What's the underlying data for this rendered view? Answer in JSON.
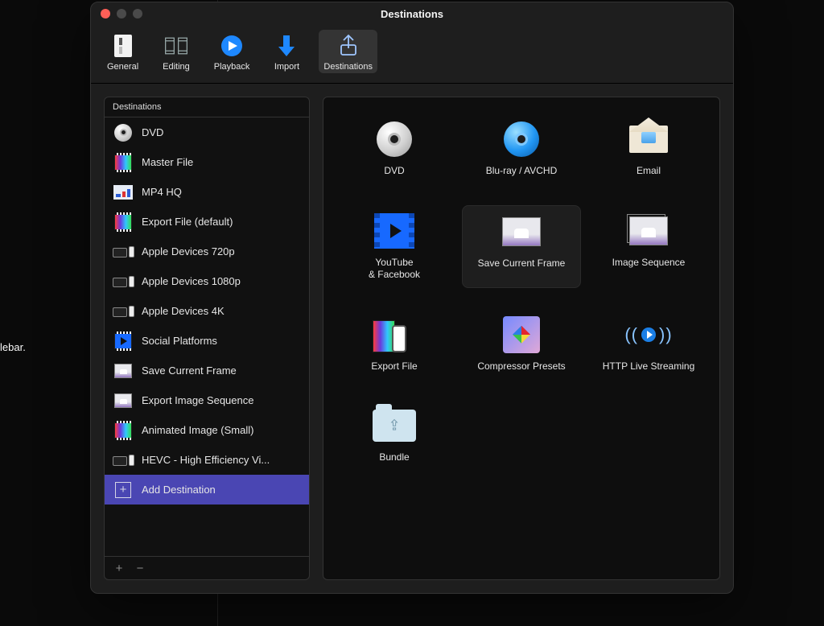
{
  "behind_text": "lebar.",
  "window": {
    "title": "Destinations",
    "toolbar": [
      {
        "id": "general",
        "label": "General",
        "icon": "general-icon",
        "selected": false
      },
      {
        "id": "editing",
        "label": "Editing",
        "icon": "editing-icon",
        "selected": false
      },
      {
        "id": "playback",
        "label": "Playback",
        "icon": "playback-icon",
        "selected": false
      },
      {
        "id": "import",
        "label": "Import",
        "icon": "import-icon",
        "selected": false
      },
      {
        "id": "destinations",
        "label": "Destinations",
        "icon": "destinations-icon",
        "selected": true
      }
    ]
  },
  "sidebar": {
    "header": "Destinations",
    "items": [
      {
        "icon": "dvd-disc-icon",
        "label": "DVD"
      },
      {
        "icon": "filmstrip-icon",
        "label": "Master File"
      },
      {
        "icon": "mp4-icon",
        "label": "MP4 HQ"
      },
      {
        "icon": "filmstrip-icon",
        "label": "Export File (default)"
      },
      {
        "icon": "devices-icon",
        "label": "Apple Devices 720p"
      },
      {
        "icon": "devices-icon",
        "label": "Apple Devices 1080p"
      },
      {
        "icon": "devices-icon",
        "label": "Apple Devices 4K"
      },
      {
        "icon": "social-icon",
        "label": "Social Platforms"
      },
      {
        "icon": "frame-thumb-icon",
        "label": "Save Current Frame"
      },
      {
        "icon": "frame-thumb-icon",
        "label": "Export Image Sequence"
      },
      {
        "icon": "filmstrip-icon",
        "label": "Animated Image (Small)"
      },
      {
        "icon": "devices-icon",
        "label": "HEVC - High Efficiency Vi..."
      },
      {
        "icon": "plus-box-icon",
        "label": "Add Destination",
        "highlight": true
      }
    ],
    "footer": {
      "add": "+",
      "remove": "−"
    }
  },
  "grid": [
    {
      "icon": "dvd-disc-icon",
      "label": "DVD"
    },
    {
      "icon": "bluray-disc-icon",
      "label": "Blu-ray / AVCHD"
    },
    {
      "icon": "email-icon",
      "label": "Email"
    },
    {
      "icon": "youtube-fb-icon",
      "label": "YouTube\n& Facebook"
    },
    {
      "icon": "frame-thumb-icon",
      "label": "Save Current Frame",
      "selected": true
    },
    {
      "icon": "image-seq-icon",
      "label": "Image Sequence"
    },
    {
      "icon": "export-file-icon",
      "label": "Export File"
    },
    {
      "icon": "compressor-icon",
      "label": "Compressor Presets"
    },
    {
      "icon": "hls-icon",
      "label": "HTTP Live Streaming"
    },
    {
      "icon": "bundle-icon",
      "label": "Bundle"
    }
  ]
}
